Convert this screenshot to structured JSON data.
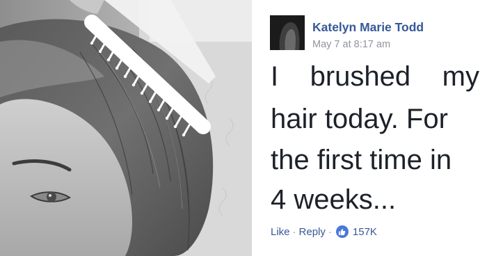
{
  "comment": {
    "author": "Katelyn Marie Todd",
    "timestamp": "May 7 at 8:17 am",
    "text_lines": [
      [
        "I",
        "brushed",
        "my"
      ],
      "hair today. For",
      "the first time in",
      "4 weeks..."
    ],
    "actions": {
      "like_label": "Like",
      "separator": "·",
      "reply_label": "Reply",
      "reaction_count": "157K"
    }
  },
  "colors": {
    "author_link": "#365899",
    "meta_grey": "#90949c",
    "comment_text": "#1d2129",
    "like_badge": "#4a77d9",
    "photo_tone": "grayscale"
  },
  "icons": {
    "like_reaction": "thumbs-up-icon",
    "hair_comb": "comb-icon"
  }
}
